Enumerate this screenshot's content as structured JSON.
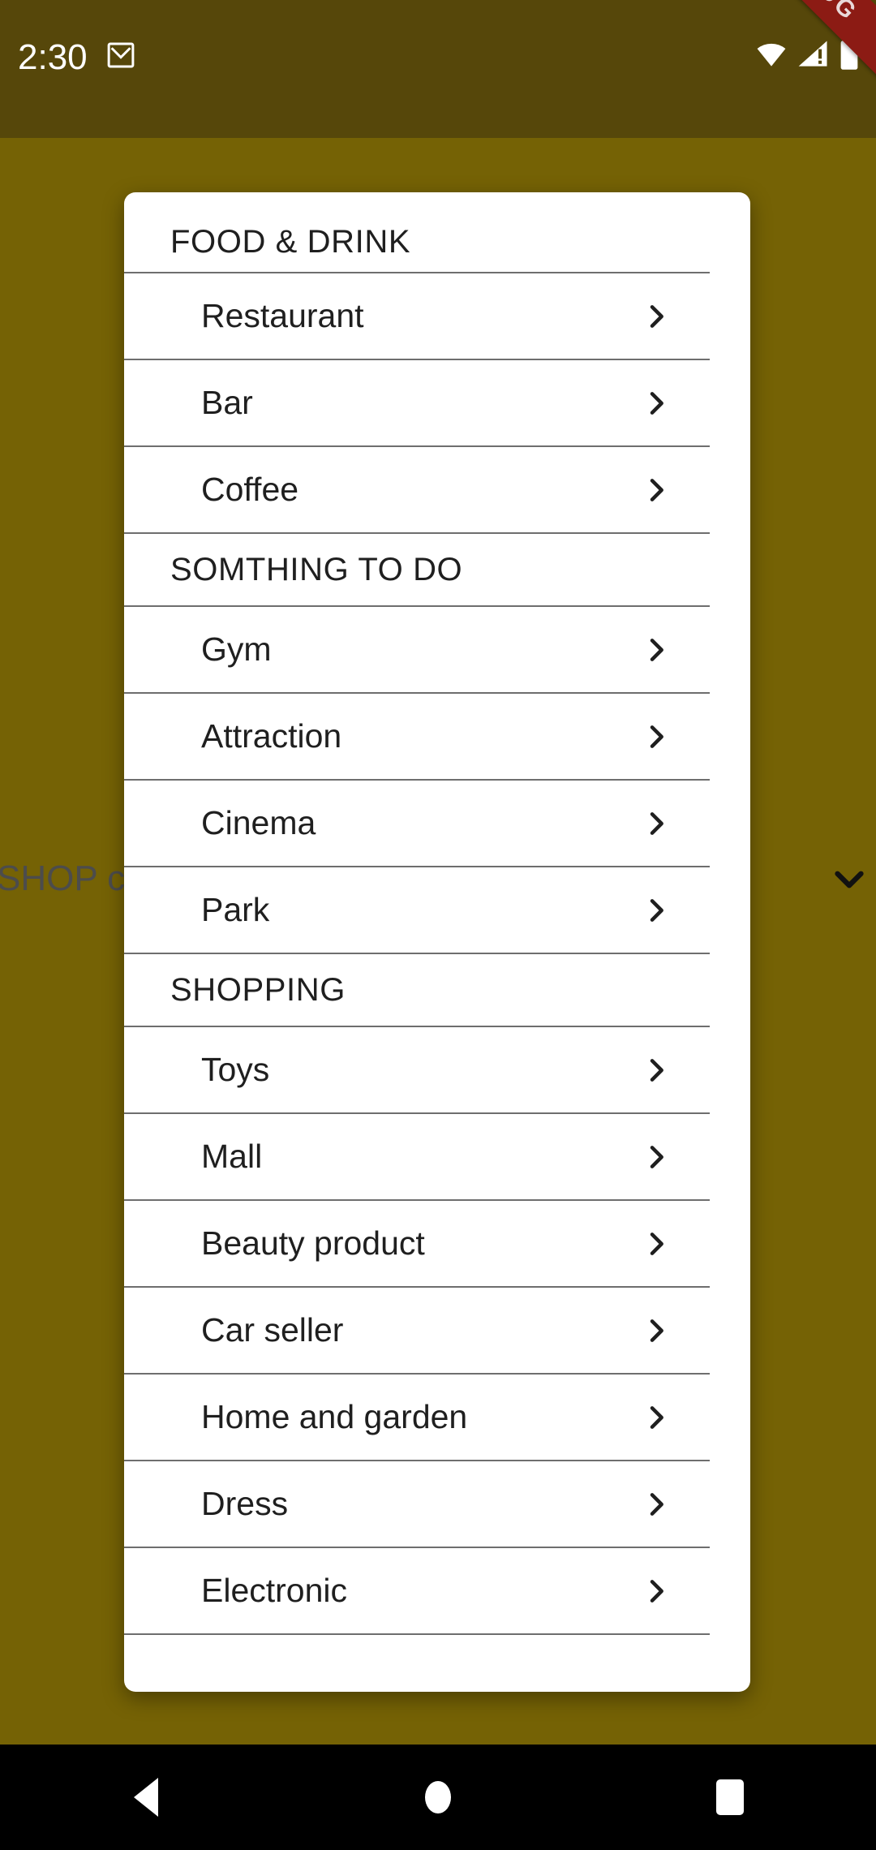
{
  "status_bar": {
    "time": "2:30",
    "icons": [
      "mail-icon",
      "wifi-icon",
      "cell-signal-warning-icon",
      "battery-icon"
    ],
    "background_color": "#56470a",
    "debug_ribbon_label": "DEBUG",
    "debug_ribbon_color": "#8c1b14"
  },
  "background": {
    "color": "#756205",
    "partial_text": "SHOP ca",
    "chevron_icon": "chevron-down-icon"
  },
  "card": {
    "background_color": "#ffffff",
    "sections": [
      {
        "header": "FOOD & DRINK",
        "items": [
          {
            "label": "Restaurant",
            "trailing_icon": "chevron-right-icon"
          },
          {
            "label": "Bar",
            "trailing_icon": "chevron-right-icon"
          },
          {
            "label": "Coffee",
            "trailing_icon": "chevron-right-icon"
          }
        ]
      },
      {
        "header": "SOMTHING TO DO",
        "items": [
          {
            "label": "Gym",
            "trailing_icon": "chevron-right-icon"
          },
          {
            "label": "Attraction",
            "trailing_icon": "chevron-right-icon"
          },
          {
            "label": "Cinema",
            "trailing_icon": "chevron-right-icon"
          },
          {
            "label": "Park",
            "trailing_icon": "chevron-right-icon"
          }
        ]
      },
      {
        "header": "SHOPPING",
        "items": [
          {
            "label": "Toys",
            "trailing_icon": "chevron-right-icon"
          },
          {
            "label": "Mall",
            "trailing_icon": "chevron-right-icon"
          },
          {
            "label": "Beauty product",
            "trailing_icon": "chevron-right-icon"
          },
          {
            "label": "Car seller",
            "trailing_icon": "chevron-right-icon"
          },
          {
            "label": "Home and garden",
            "trailing_icon": "chevron-right-icon"
          },
          {
            "label": "Dress",
            "trailing_icon": "chevron-right-icon"
          },
          {
            "label": "Electronic",
            "trailing_icon": "chevron-right-icon"
          }
        ]
      }
    ]
  },
  "navigation_bar": {
    "background_color": "#000000",
    "buttons": [
      {
        "name": "back-button",
        "icon": "triangle-left-icon"
      },
      {
        "name": "home-button",
        "icon": "circle-icon"
      },
      {
        "name": "recents-button",
        "icon": "square-icon"
      }
    ]
  }
}
